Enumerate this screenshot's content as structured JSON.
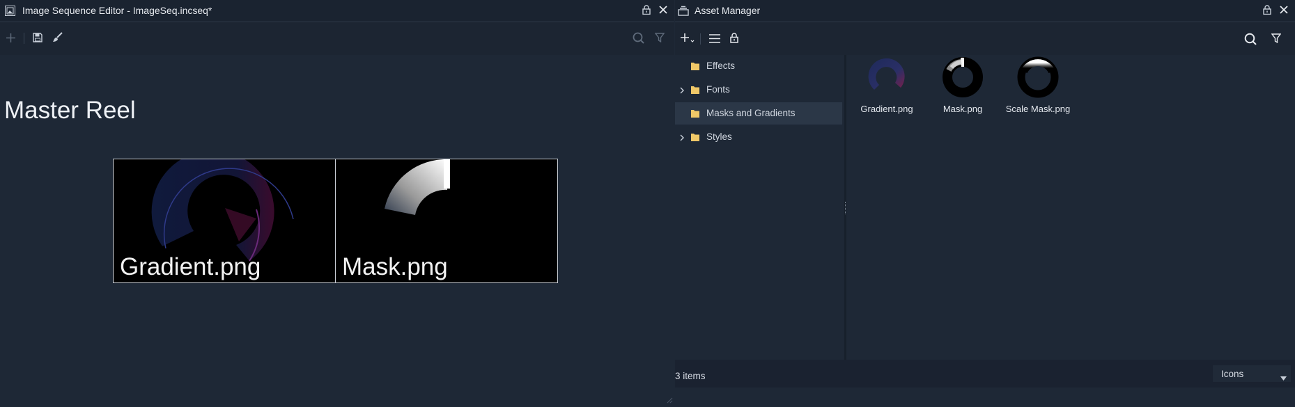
{
  "left_panel": {
    "title": "Image Sequence Editor - ImageSeq.incseq*",
    "reel_title": "Master Reel",
    "frames": [
      {
        "caption": "Gradient.png"
      },
      {
        "caption": "Mask.png"
      }
    ]
  },
  "right_panel": {
    "title": "Asset Manager",
    "tree": [
      {
        "label": "Effects",
        "expandable": false,
        "selected": false
      },
      {
        "label": "Fonts",
        "expandable": true,
        "selected": false
      },
      {
        "label": "Masks and Gradients",
        "expandable": false,
        "selected": true
      },
      {
        "label": "Styles",
        "expandable": true,
        "selected": false
      }
    ],
    "assets": [
      {
        "label": "Gradient.png"
      },
      {
        "label": "Mask.png"
      },
      {
        "label": "Scale Mask.png"
      }
    ],
    "status": {
      "count": "3 items",
      "view_mode": "Icons"
    }
  },
  "colors": {
    "background": "#1e2836",
    "titlebar": "#1a2330",
    "selection": "#2b3747",
    "folder": "#f0c868",
    "accent_purple": "#7a3fb0"
  }
}
